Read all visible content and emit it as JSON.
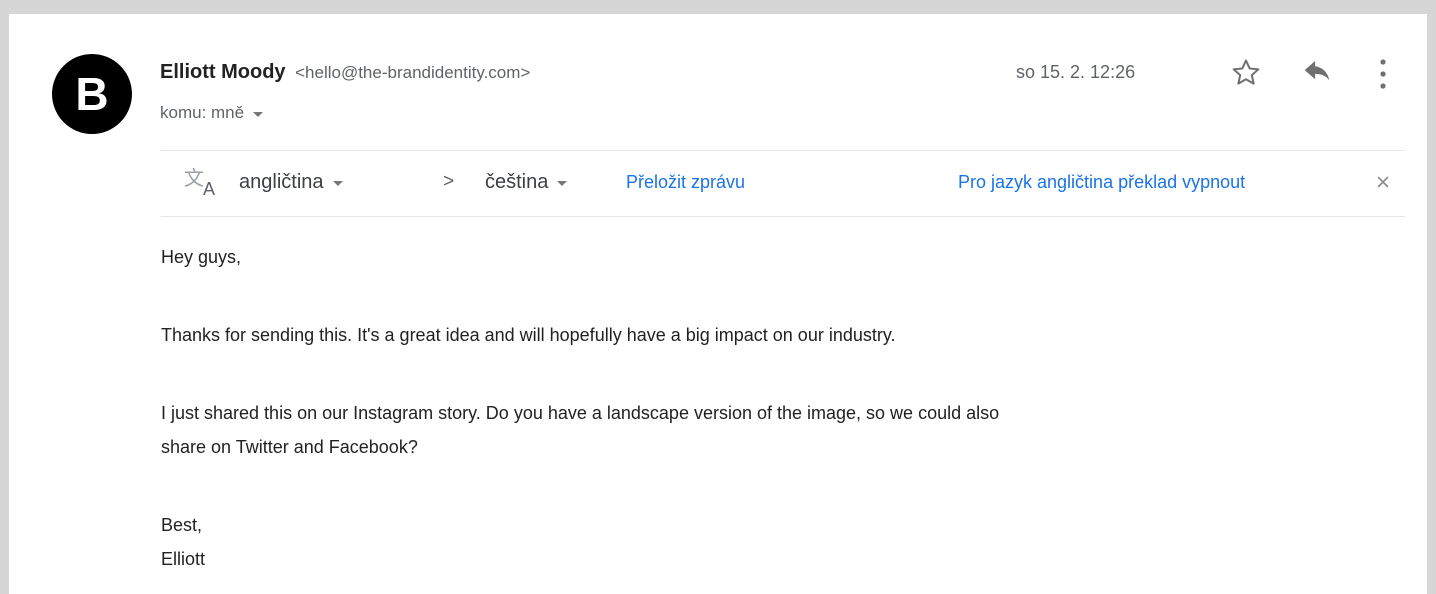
{
  "email": {
    "avatar_letter": "B",
    "sender_name": "Elliott Moody",
    "sender_email": "<hello@the-brandidentity.com>",
    "recipient_line": "komu: mně",
    "date": "so 15. 2. 12:26"
  },
  "icons": {
    "star": "star-outline-icon",
    "reply": "reply-icon",
    "more": "more-vertical-icon",
    "translate": "translate-icon",
    "close": "close-icon"
  },
  "translation_bar": {
    "source_language": "angličtina",
    "separator": ">",
    "target_language": "čeština",
    "translate_link": "Přeložit zprávu",
    "disable_link": "Pro jazyk angličtina překlad vypnout"
  },
  "body": {
    "greeting": "Hey guys,",
    "paragraph1": "Thanks for sending this. It's a great idea and will hopefully have a big impact on our industry.",
    "paragraph2_line1": "I just shared this on our Instagram story. Do you have a landscape version of the image, so we could also",
    "paragraph2_line2": "share on Twitter and Facebook?",
    "signoff": "Best,",
    "signature": "Elliott"
  },
  "colors": {
    "background": "#d6d6d6",
    "link": "#1a73e8",
    "text": "#222222",
    "muted": "#5f6368"
  }
}
